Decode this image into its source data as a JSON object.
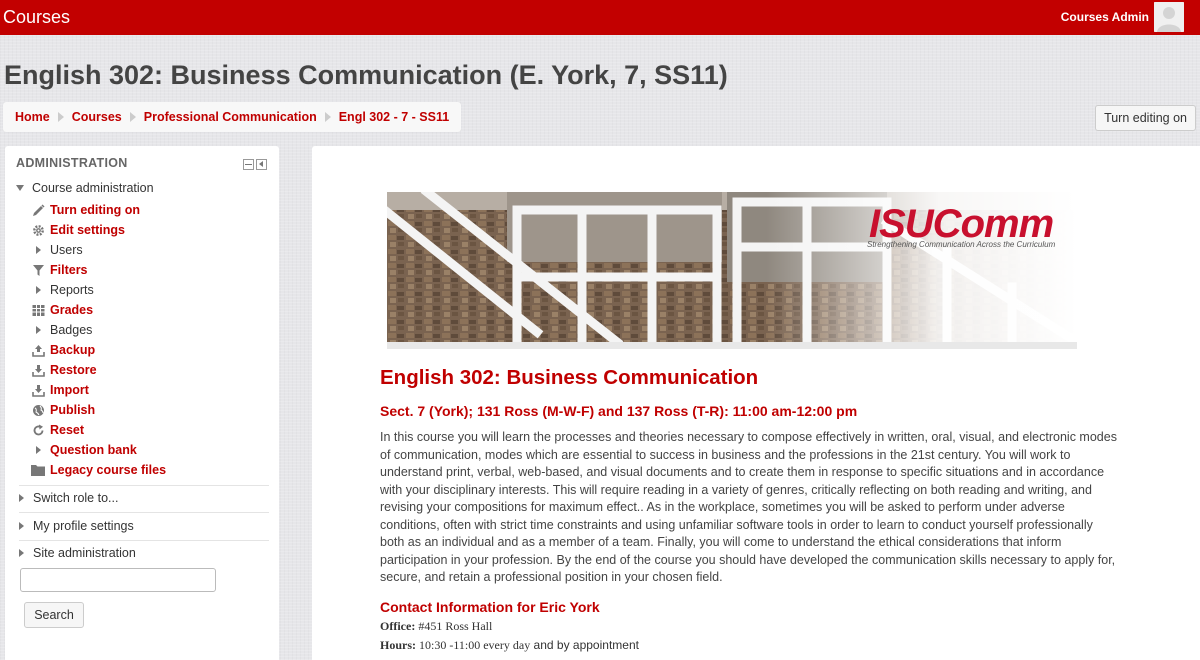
{
  "colors": {
    "brand_red": "#c20000",
    "link_red": "#c00000",
    "page_bg": "#e6e6e9"
  },
  "topbar": {
    "title": "Courses",
    "user_name": "Courses Admin",
    "avatar_icon": "user-avatar-icon"
  },
  "page_title": "English 302: Business Communication (E. York, 7, SS11)",
  "breadcrumb": [
    "Home",
    "Courses",
    "Professional Communication",
    "Engl 302 - 7 - SS11"
  ],
  "edit_button": "Turn editing on",
  "admin": {
    "title": "ADMINISTRATION",
    "course_admin_label": "Course administration",
    "items": [
      {
        "label": "Turn editing on",
        "icon": "pencil-icon"
      },
      {
        "label": "Edit settings",
        "icon": "gear-icon"
      },
      {
        "label": "Users",
        "icon": "expand-arrow-icon"
      },
      {
        "label": "Filters",
        "icon": "filter-icon"
      },
      {
        "label": "Reports",
        "icon": "expand-arrow-icon"
      },
      {
        "label": "Grades",
        "icon": "grades-table-icon"
      },
      {
        "label": "Badges",
        "icon": "expand-arrow-icon"
      },
      {
        "label": "Backup",
        "icon": "upload-icon"
      },
      {
        "label": "Restore",
        "icon": "download-icon"
      },
      {
        "label": "Import",
        "icon": "import-icon"
      },
      {
        "label": "Publish",
        "icon": "globe-icon"
      },
      {
        "label": "Reset",
        "icon": "reset-icon"
      },
      {
        "label": "Question bank",
        "icon": "expand-arrow-icon"
      },
      {
        "label": "Legacy course files",
        "icon": "folder-icon"
      }
    ],
    "sections": [
      "Switch role to...",
      "My profile settings",
      "Site administration"
    ],
    "search_value": "",
    "search_button": "Search"
  },
  "content": {
    "banner_title": "ISUComm",
    "banner_tagline": "Strengthening Communication Across the Curriculum",
    "course_title": "English 302: Business Communication",
    "section_line": "Sect. 7 (York); 131 Ross (M-W-F) and 137 Ross (T-R): 11:00 am-12:00 pm",
    "description": "In this course you will learn the processes and theories necessary to compose effectively in written, oral, visual, and electronic modes of communication, modes which are essential to success in business and the professions in the 21st century. You will work to understand print, verbal, web-based, and visual documents and to create them in response to specific situations and in accordance with your disciplinary interests. This will require reading in a variety of genres, critically reflecting on both reading and writing, and revising your compositions for maximum effect.. As in the workplace, sometimes you will be asked to perform under adverse conditions, often with strict time constraints and using unfamiliar software tools in order to learn to conduct yourself professionally both as an individual and as a member of a team. Finally, you will come to understand the ethical considerations that inform participation in your profession. By the end of the course you should have developed the communication skills necessary to apply for, secure, and retain a professional position in your chosen field.",
    "contact_heading": "Contact Information for Eric York",
    "office_label": "Office:",
    "office_value": "#451 Ross Hall",
    "hours_label": "Hours:",
    "hours_value": "10:30 -11:00 every day",
    "hours_suffix": "and by appointment"
  }
}
